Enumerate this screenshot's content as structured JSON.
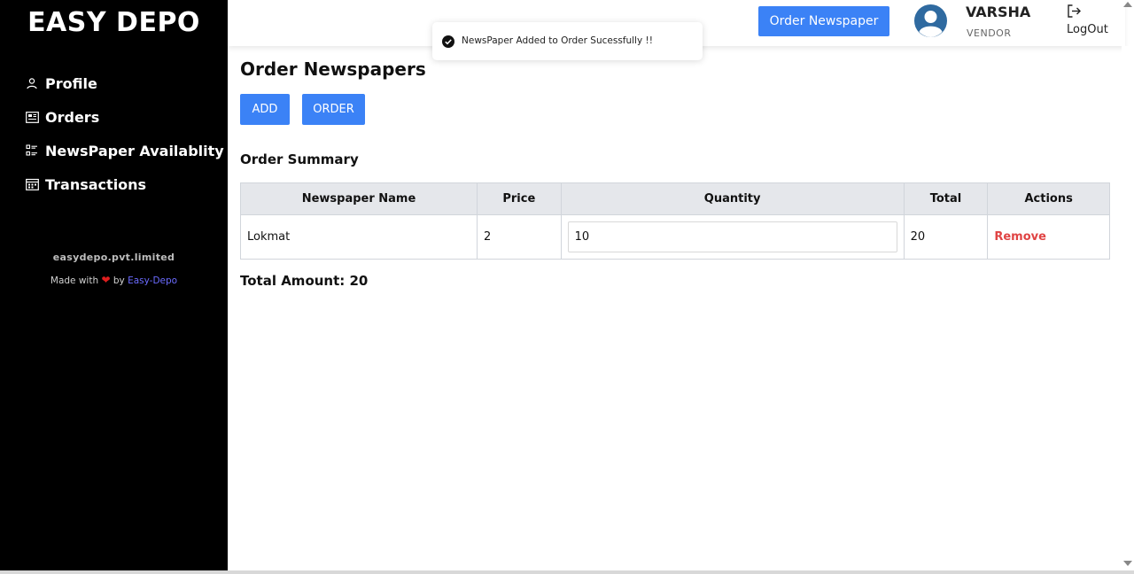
{
  "sidebar": {
    "brand": "EASY DEPO",
    "items": [
      {
        "label": "Profile",
        "icon": "user-icon"
      },
      {
        "label": "Orders",
        "icon": "newspaper-icon"
      },
      {
        "label": "NewsPaper Availablity",
        "icon": "list-icon"
      },
      {
        "label": "Transactions",
        "icon": "calendar-icon"
      }
    ],
    "company": "easydepo.pvt.limited",
    "made_with_prefix": "Made with",
    "made_with_by": "by",
    "made_with_link": "Easy-Depo"
  },
  "header": {
    "order_button": "Order Newspaper",
    "user_name": "VARSHA",
    "user_role": "VENDOR",
    "logout": "LogOut"
  },
  "toast": {
    "message": "NewsPaper Added to Order Sucessfully !!"
  },
  "main": {
    "title": "Order Newspapers",
    "add_button": "ADD",
    "order_button": "ORDER",
    "summary_title": "Order Summary",
    "columns": [
      "Newspaper Name",
      "Price",
      "Quantity",
      "Total",
      "Actions"
    ],
    "rows": [
      {
        "name": "Lokmat",
        "price": "2",
        "quantity": "10",
        "total": "20",
        "action": "Remove"
      }
    ],
    "total_amount": "Total Amount: 20"
  },
  "colors": {
    "accent": "#3b82f6",
    "sidebar_bg": "#000000",
    "remove": "#e04444"
  }
}
